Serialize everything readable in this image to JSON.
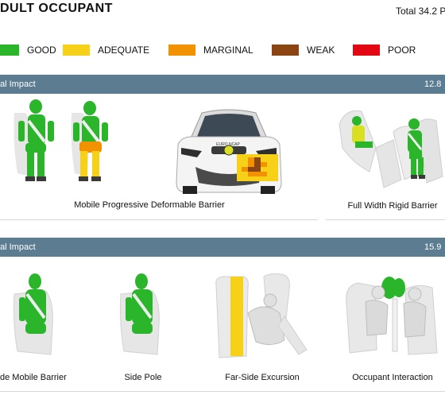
{
  "header": {
    "title": "DULT OCCUPANT",
    "total": "Total 34.2 P"
  },
  "legend": [
    {
      "label": "GOOD",
      "color": "#2bb52b"
    },
    {
      "label": "ADEQUATE",
      "color": "#f7d117"
    },
    {
      "label": "MARGINAL",
      "color": "#f39200"
    },
    {
      "label": "WEAK",
      "color": "#8b4513"
    },
    {
      "label": "POOR",
      "color": "#e30613"
    }
  ],
  "frontal": {
    "label": "al Impact",
    "score": "12.8",
    "tests": [
      {
        "caption": "Mobile Progressive Deformable Barrier"
      },
      {
        "caption": "Full Width Rigid Barrier"
      }
    ]
  },
  "lateral": {
    "label": "al Impact",
    "score": "15.9",
    "tests": [
      {
        "caption": "de Mobile Barrier"
      },
      {
        "caption": "Side Pole"
      },
      {
        "caption": "Far-Side Excursion"
      },
      {
        "caption": "Occupant Interaction"
      }
    ]
  },
  "car_logo": "EURO NCAP",
  "colors": {
    "good": "#2bb52b",
    "adequate": "#f7d117",
    "marginal": "#f39200",
    "weak": "#8b4513",
    "poor": "#e30613",
    "bar": "#5b7c91"
  }
}
